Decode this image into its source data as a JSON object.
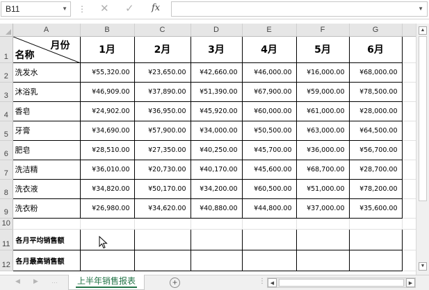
{
  "formula_bar": {
    "name_box": "B11",
    "cancel_icon": "✕",
    "enter_icon": "✓",
    "fx_label": "fx",
    "formula": ""
  },
  "columns": [
    "A",
    "B",
    "C",
    "D",
    "E",
    "F",
    "G"
  ],
  "rows": [
    "1",
    "2",
    "3",
    "4",
    "5",
    "6",
    "7",
    "8",
    "9",
    "10",
    "11",
    "12"
  ],
  "header": {
    "diag_top": "月份",
    "diag_bottom": "名称",
    "months": [
      "1月",
      "2月",
      "3月",
      "4月",
      "5月",
      "6月"
    ]
  },
  "products": [
    {
      "name": "洗发水",
      "values": [
        "¥55,320.00",
        "¥23,650.00",
        "¥42,660.00",
        "¥46,000.00",
        "¥16,000.00",
        "¥68,000.00"
      ]
    },
    {
      "name": "沐浴乳",
      "values": [
        "¥46,909.00",
        "¥37,890.00",
        "¥51,390.00",
        "¥67,900.00",
        "¥59,000.00",
        "¥78,500.00"
      ]
    },
    {
      "name": "香皂",
      "values": [
        "¥24,902.00",
        "¥36,950.00",
        "¥45,920.00",
        "¥60,000.00",
        "¥61,000.00",
        "¥28,000.00"
      ]
    },
    {
      "name": "牙膏",
      "values": [
        "¥34,690.00",
        "¥57,900.00",
        "¥34,000.00",
        "¥50,500.00",
        "¥63,000.00",
        "¥64,500.00"
      ]
    },
    {
      "name": "肥皂",
      "values": [
        "¥28,510.00",
        "¥27,350.00",
        "¥40,250.00",
        "¥45,700.00",
        "¥36,000.00",
        "¥56,700.00"
      ]
    },
    {
      "name": "洗洁精",
      "values": [
        "¥36,010.00",
        "¥20,730.00",
        "¥40,170.00",
        "¥45,600.00",
        "¥68,700.00",
        "¥28,700.00"
      ]
    },
    {
      "name": "洗衣液",
      "values": [
        "¥34,820.00",
        "¥50,170.00",
        "¥34,200.00",
        "¥60,500.00",
        "¥51,000.00",
        "¥78,200.00"
      ]
    },
    {
      "name": "洗衣粉",
      "values": [
        "¥26,980.00",
        "¥34,620.00",
        "¥40,880.00",
        "¥44,800.00",
        "¥37,000.00",
        "¥35,600.00"
      ]
    }
  ],
  "stats": {
    "avg_label": "各月平均销售额",
    "max_label": "各月最高销售额"
  },
  "sheet_tabs": {
    "active": "上半年销售报表",
    "add_icon": "⊕",
    "dots": "⋮"
  },
  "colors": {
    "tab_accent": "#217346",
    "header_bg": "#e6e6e6"
  }
}
